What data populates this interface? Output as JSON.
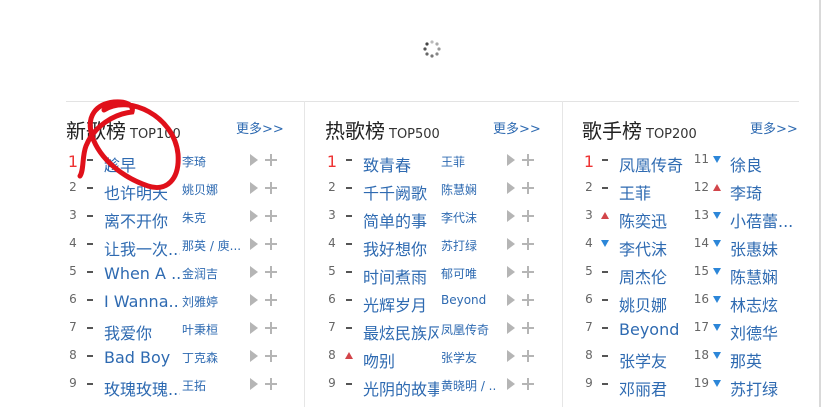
{
  "panels": [
    {
      "title": "新歌榜",
      "subtitle": "TOP100",
      "more": "更多>>",
      "rows": [
        {
          "rank": "1",
          "trend": "same",
          "song": "趁早",
          "artist": "李琦"
        },
        {
          "rank": "2",
          "trend": "same",
          "song": "也许明天",
          "artist": "姚贝娜"
        },
        {
          "rank": "3",
          "trend": "same",
          "song": "离不开你",
          "artist": "朱克"
        },
        {
          "rank": "4",
          "trend": "same",
          "song": "让我一次...",
          "artist": "那英 / 庾..."
        },
        {
          "rank": "5",
          "trend": "same",
          "song": "When A ...",
          "artist": "金润吉"
        },
        {
          "rank": "6",
          "trend": "same",
          "song": "I Wanna...",
          "artist": "刘雅婷"
        },
        {
          "rank": "7",
          "trend": "same",
          "song": "我爱你",
          "artist": "叶秉桓"
        },
        {
          "rank": "8",
          "trend": "same",
          "song": "Bad Boy",
          "artist": "丁克森"
        },
        {
          "rank": "9",
          "trend": "same",
          "song": "玫瑰玫瑰...",
          "artist": "王拓"
        }
      ]
    },
    {
      "title": "热歌榜",
      "subtitle": "TOP500",
      "more": "更多>>",
      "rows": [
        {
          "rank": "1",
          "trend": "same",
          "song": "致青春",
          "artist": "王菲"
        },
        {
          "rank": "2",
          "trend": "same",
          "song": "千千阙歌",
          "artist": "陈慧娴"
        },
        {
          "rank": "3",
          "trend": "same",
          "song": "简单的事",
          "artist": "李代沫"
        },
        {
          "rank": "4",
          "trend": "same",
          "song": "我好想你",
          "artist": "苏打绿"
        },
        {
          "rank": "5",
          "trend": "same",
          "song": "时间煮雨",
          "artist": "郁可唯"
        },
        {
          "rank": "6",
          "trend": "same",
          "song": "光辉岁月",
          "artist": "Beyond"
        },
        {
          "rank": "7",
          "trend": "same",
          "song": "最炫民族风",
          "artist": "凤凰传奇"
        },
        {
          "rank": "8",
          "trend": "up",
          "song": "吻别",
          "artist": "张学友"
        },
        {
          "rank": "9",
          "trend": "same",
          "song": "光阴的故事",
          "artist": "黄晓明 / ..."
        }
      ]
    },
    {
      "title": "歌手榜",
      "subtitle": "TOP200",
      "more": "更多>>",
      "left": [
        {
          "rank": "1",
          "trend": "same",
          "name": "凤凰传奇"
        },
        {
          "rank": "2",
          "trend": "same",
          "name": "王菲"
        },
        {
          "rank": "3",
          "trend": "up",
          "name": "陈奕迅"
        },
        {
          "rank": "4",
          "trend": "down",
          "name": "李代沫"
        },
        {
          "rank": "5",
          "trend": "same",
          "name": "周杰伦"
        },
        {
          "rank": "6",
          "trend": "same",
          "name": "姚贝娜"
        },
        {
          "rank": "7",
          "trend": "same",
          "name": "Beyond"
        },
        {
          "rank": "8",
          "trend": "same",
          "name": "张学友"
        },
        {
          "rank": "9",
          "trend": "same",
          "name": "邓丽君"
        }
      ],
      "right": [
        {
          "rank": "11",
          "trend": "down",
          "name": "徐良"
        },
        {
          "rank": "12",
          "trend": "up",
          "name": "李琦"
        },
        {
          "rank": "13",
          "trend": "down",
          "name": "小蓓蕾..."
        },
        {
          "rank": "14",
          "trend": "down",
          "name": "张惠妹"
        },
        {
          "rank": "15",
          "trend": "down",
          "name": "陈慧娴"
        },
        {
          "rank": "16",
          "trend": "down",
          "name": "林志炫"
        },
        {
          "rank": "17",
          "trend": "down",
          "name": "刘德华"
        },
        {
          "rank": "18",
          "trend": "down",
          "name": "那英"
        },
        {
          "rank": "19",
          "trend": "down",
          "name": "苏打绿"
        }
      ]
    }
  ],
  "colors": {
    "link": "#2e6ab1",
    "top_rank": "#e33333",
    "up": "#d2454a",
    "down": "#2c86d8",
    "annotation": "#e0101a"
  }
}
